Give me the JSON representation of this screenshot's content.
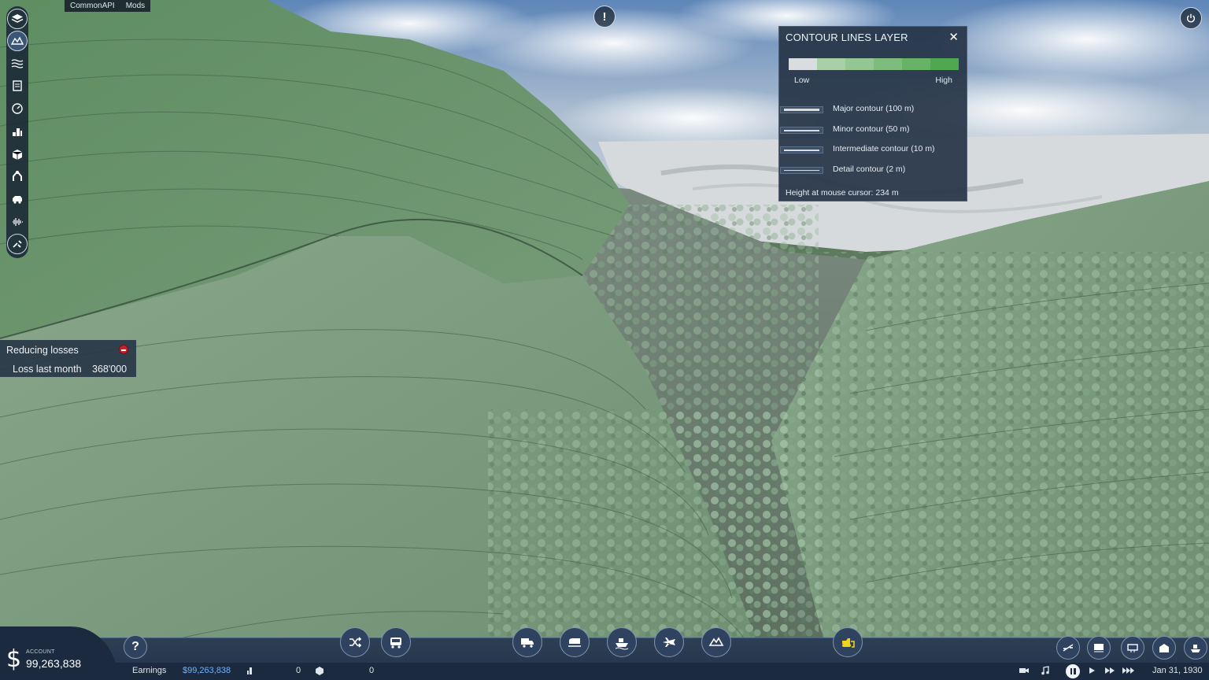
{
  "modbar": {
    "items": [
      "CommonAPI",
      "Mods"
    ]
  },
  "sidebar": {
    "items": [
      {
        "icon": "layers-icon"
      },
      {
        "icon": "terrain-icon",
        "active": true
      },
      {
        "icon": "water-icon"
      },
      {
        "icon": "document-icon"
      },
      {
        "icon": "speedometer-icon"
      },
      {
        "icon": "town-icon"
      },
      {
        "icon": "cargo-icon"
      },
      {
        "icon": "network-icon"
      },
      {
        "icon": "vehicle-icon"
      },
      {
        "icon": "sound-icon"
      },
      {
        "icon": "tools-icon"
      }
    ]
  },
  "top_buttons": {
    "alert_label": "!",
    "alert_icon": "alert-icon",
    "power_icon": "power-icon"
  },
  "contour_panel": {
    "title": "CONTOUR LINES LAYER",
    "close_label": "✕",
    "gradient_colors": [
      "#d9dde0",
      "#a8cfa8",
      "#93c693",
      "#7dbc7d",
      "#68b268",
      "#4fa84f"
    ],
    "low_label": "Low",
    "high_label": "High",
    "legend": [
      {
        "label": "Major contour (100 m)",
        "weight": 3
      },
      {
        "label": "Minor contour (50 m)",
        "weight": 2
      },
      {
        "label": "Intermediate contour (10 m)",
        "weight": 2
      },
      {
        "label": "Detail contour (2 m)",
        "weight": 1
      }
    ],
    "cursor_height": "Height at mouse cursor: 234 m"
  },
  "loss_widget": {
    "title": "Reducing losses",
    "label": "Loss last month",
    "value": "368'000"
  },
  "account": {
    "symbol": "$",
    "label": "ACCOUNT",
    "value": "99,263,838"
  },
  "bottom_toolbar": {
    "help_label": "?",
    "tools": [
      "shuffle-icon",
      "bus-icon",
      "truck-icon",
      "train-icon",
      "ship-icon",
      "plane-icon",
      "terrain-icon",
      "bulldozer-icon"
    ],
    "right_tools": [
      "road-icon",
      "rail-icon",
      "station-icon",
      "depot-icon",
      "harbor-icon"
    ]
  },
  "statusbar": {
    "earnings_label": "Earnings",
    "earnings_value": "$99,263,838",
    "population_value": "0",
    "cargo_value": "0",
    "date": "Jan 31, 1930"
  }
}
